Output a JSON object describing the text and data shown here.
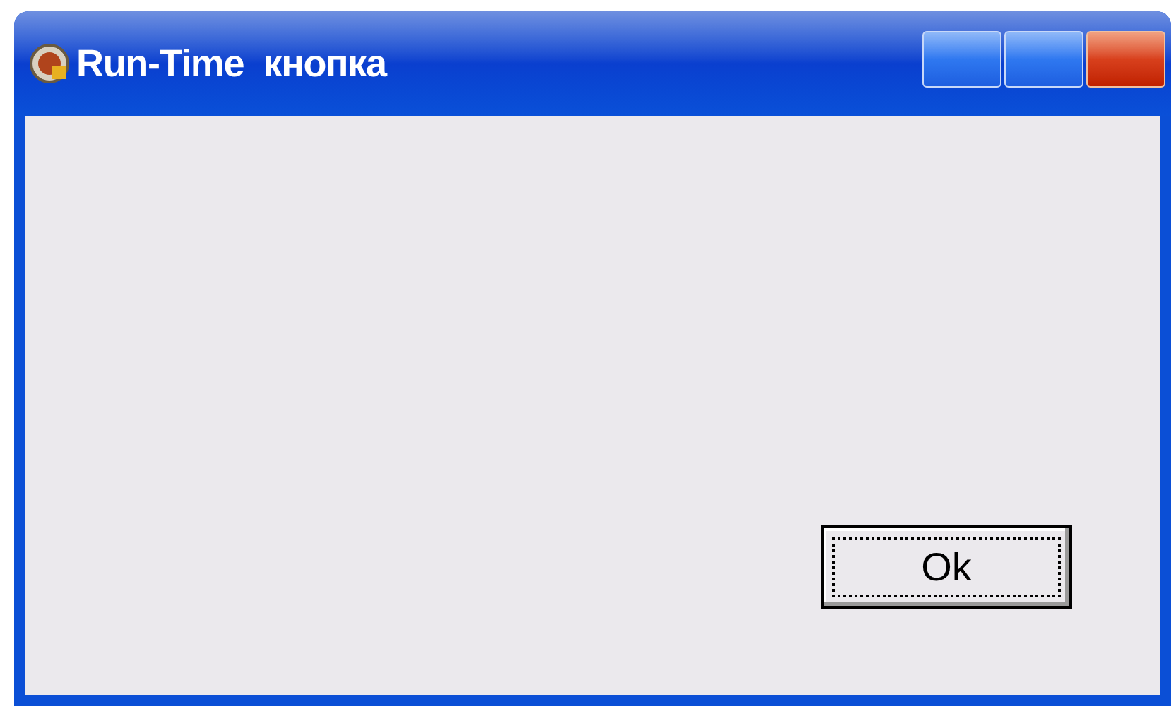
{
  "window": {
    "title": "Run-Time  кнопка",
    "caption_buttons": [
      {
        "kind": "minimize"
      },
      {
        "kind": "maximize"
      },
      {
        "kind": "close"
      }
    ]
  },
  "button": {
    "label": "Ok",
    "focused": true
  }
}
